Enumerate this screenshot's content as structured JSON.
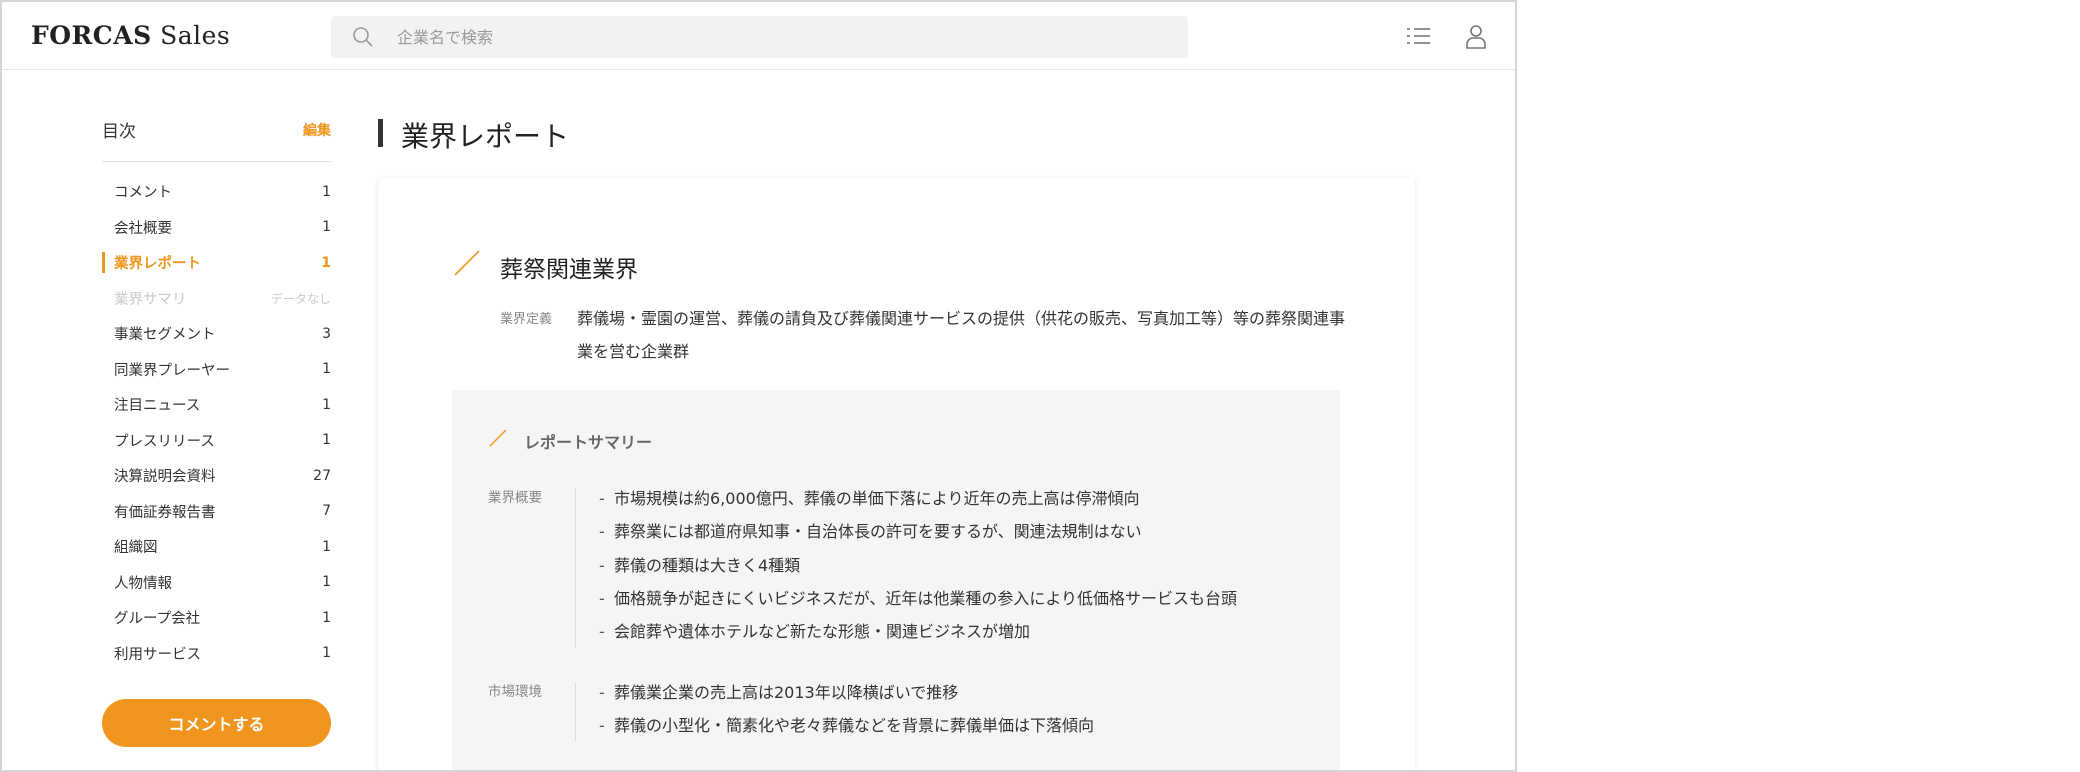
{
  "header": {
    "logo_brand": "FORCAS",
    "logo_sub": "Sales",
    "search_placeholder": "企業名で検索",
    "icons": [
      "search-icon",
      "list-icon",
      "user-icon"
    ]
  },
  "sidebar": {
    "title": "目次",
    "edit_label": "編集",
    "items": [
      {
        "label": "コメント",
        "count": "1"
      },
      {
        "label": "会社概要",
        "count": "1"
      },
      {
        "label": "業界レポート",
        "count": "1"
      },
      {
        "label": "業界サマリ",
        "count": "データなし"
      },
      {
        "label": "事業セグメント",
        "count": "3"
      },
      {
        "label": "同業界プレーヤー",
        "count": "1"
      },
      {
        "label": "注目ニュース",
        "count": "1"
      },
      {
        "label": "プレスリリース",
        "count": "1"
      },
      {
        "label": "決算説明会資料",
        "count": "27"
      },
      {
        "label": "有価証券報告書",
        "count": "7"
      },
      {
        "label": "組織図",
        "count": "1"
      },
      {
        "label": "人物情報",
        "count": "1"
      },
      {
        "label": "グループ会社",
        "count": "1"
      },
      {
        "label": "利用サービス",
        "count": "1"
      }
    ],
    "comment_button": "コメントする"
  },
  "main": {
    "page_title": "業界レポート",
    "section_title": "葬祭関連業界",
    "definition_label": "業界定義",
    "definition_text": "葬儀場・霊園の運営、葬儀の請負及び葬儀関連サービスの提供（供花の販売、写真加工等）等の葬祭関連事業を営む企業群",
    "summary": {
      "title": "レポートサマリー",
      "groups": [
        {
          "label": "業界概要",
          "bullets": [
            "市場規模は約6,000億円、葬儀の単価下落により近年の売上高は停滞傾向",
            "葬祭業には都道府県知事・自治体長の許可を要するが、関連法規制はない",
            "葬儀の種類は大きく4種類",
            "価格競争が起きにくいビジネスだが、近年は他業種の参入により低価格サービスも台頭",
            "会館葬や遺体ホテルなど新たな形態・関連ビジネスが増加"
          ]
        },
        {
          "label": "市場環境",
          "bullets": [
            "葬儀業企業の売上高は2013年以降横ばいで推移",
            "葬儀の小型化・簡素化や老々葬儀などを背景に葬儀単価は下落傾向"
          ]
        }
      ]
    }
  },
  "colors": {
    "accent": "#f0961e",
    "text": "#333333",
    "muted": "#888888",
    "panel": "#f5f5f5"
  }
}
